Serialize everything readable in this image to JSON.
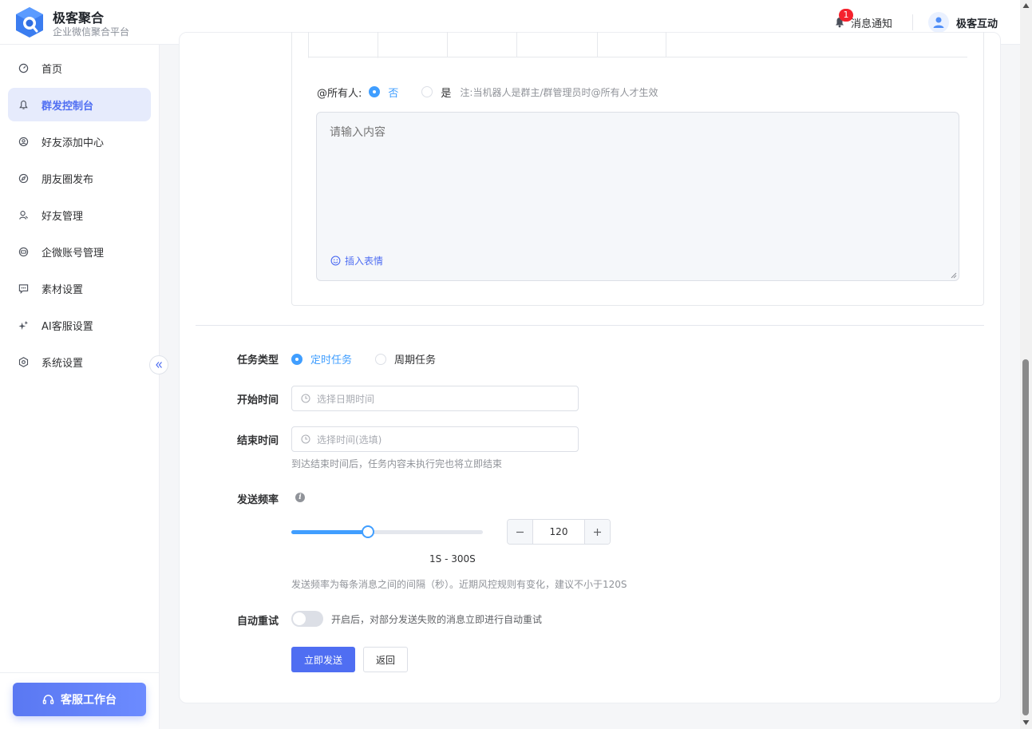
{
  "header": {
    "brand_title": "极客聚合",
    "brand_subtitle": "企业微信聚合平台",
    "notify_label": "消息通知",
    "notify_count": "1",
    "user_name": "极客互动"
  },
  "sidebar": {
    "items": [
      {
        "label": "首页",
        "icon": "dashboard-icon"
      },
      {
        "label": "群发控制台",
        "icon": "bell-icon"
      },
      {
        "label": "好友添加中心",
        "icon": "user-add-icon"
      },
      {
        "label": "朋友圈发布",
        "icon": "compass-icon"
      },
      {
        "label": "好友管理",
        "icon": "user-icon"
      },
      {
        "label": "企微账号管理",
        "icon": "id-card-icon"
      },
      {
        "label": "素材设置",
        "icon": "message-icon"
      },
      {
        "label": "AI客服设置",
        "icon": "sparkle-icon"
      },
      {
        "label": "系统设置",
        "icon": "gear-icon"
      }
    ],
    "active_index": 1,
    "cs_button": "客服工作台"
  },
  "message": {
    "at_all_label": "@所有人:",
    "at_no": "否",
    "at_yes": "是",
    "at_note": "注:当机器人是群主/群管理员时@所有人才生效",
    "content_placeholder": "请输入内容",
    "insert_emoji": "插入表情"
  },
  "form": {
    "task_type_label": "任务类型",
    "task_type_options": [
      "定时任务",
      "周期任务"
    ],
    "task_type_selected": "定时任务",
    "start_label": "开始时间",
    "start_placeholder": "选择日期时间",
    "end_label": "结束时间",
    "end_placeholder": "选择时间(选填)",
    "end_hint": "到达结束时间后，任务内容未执行完也将立即结束",
    "freq_label": "发送频率",
    "freq_value": "120",
    "freq_min": 1,
    "freq_max": 300,
    "freq_range_text": "1S - 300S",
    "freq_hint": "发送频率为每条消息之间的间隔（秒）。近期风控规则有变化，建议不小于120S",
    "retry_label": "自动重试",
    "retry_enabled": false,
    "retry_hint": "开启后，对部分发送失败的消息立即进行自动重试",
    "submit_label": "立即发送",
    "back_label": "返回"
  },
  "colors": {
    "primary": "#4f6ef2",
    "accent": "#409eff",
    "badge": "#f5222d"
  }
}
